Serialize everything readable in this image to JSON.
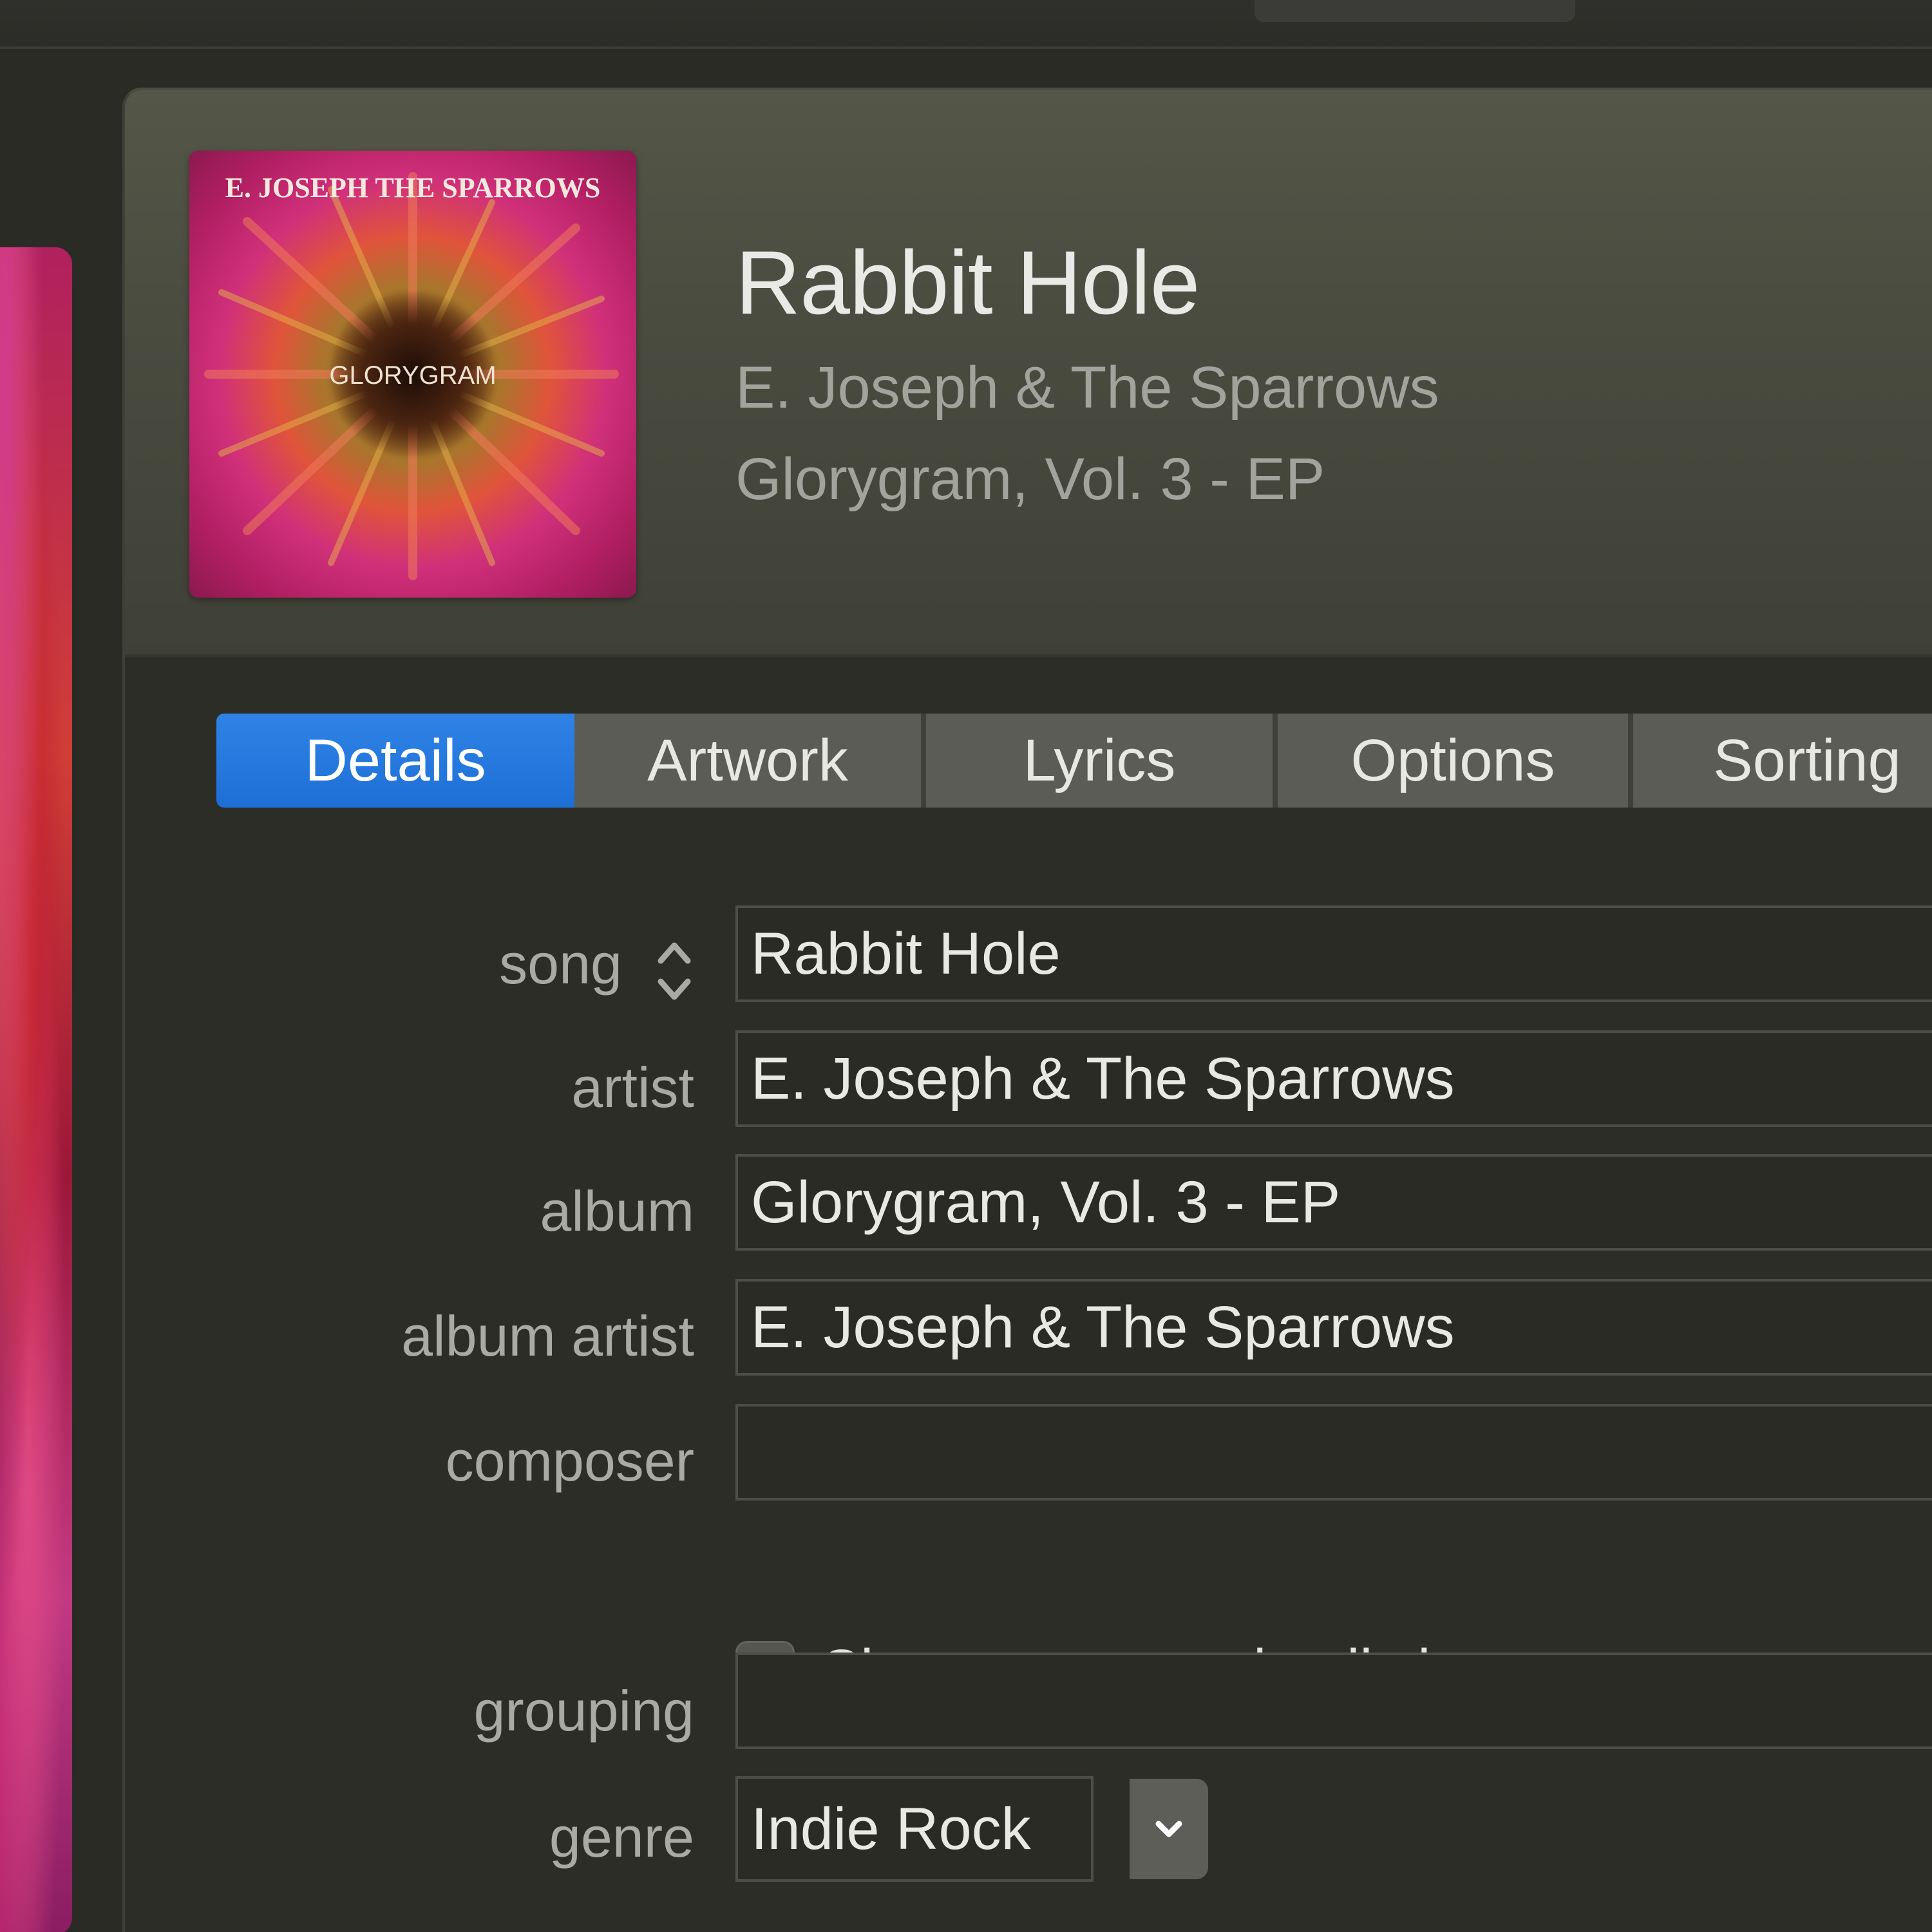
{
  "header": {
    "title": "Rabbit Hole",
    "artist": "E. Joseph & The Sparrows",
    "album": "Glorygram, Vol. 3 - EP"
  },
  "artwork": {
    "band_text": "E. JOSEPH THE SPARROWS",
    "title_text": "GLORYGRAM"
  },
  "tabs": [
    {
      "label": "Details",
      "active": true
    },
    {
      "label": "Artwork",
      "active": false
    },
    {
      "label": "Lyrics",
      "active": false
    },
    {
      "label": "Options",
      "active": false
    },
    {
      "label": "Sorting",
      "active": false
    }
  ],
  "form": {
    "song": {
      "label": "song",
      "value": "Rabbit Hole"
    },
    "artist": {
      "label": "artist",
      "value": "E. Joseph & The Sparrows"
    },
    "album": {
      "label": "album",
      "value": "Glorygram, Vol. 3 - EP"
    },
    "album_artist": {
      "label": "album artist",
      "value": "E. Joseph & The Sparrows"
    },
    "composer": {
      "label": "composer",
      "value": ""
    },
    "show_composer": {
      "label": "Show composer in all views",
      "checked": false
    },
    "grouping": {
      "label": "grouping",
      "value": ""
    },
    "genre": {
      "label": "genre",
      "value": "Indie Rock"
    }
  },
  "icons": {
    "stepper": "up-down-stepper-icon",
    "genre_dropdown": "chevron-down-icon"
  },
  "colors": {
    "accent": "#1f72da",
    "panel_bg": "#2c2d27",
    "header_bg": "#4c4e42"
  }
}
